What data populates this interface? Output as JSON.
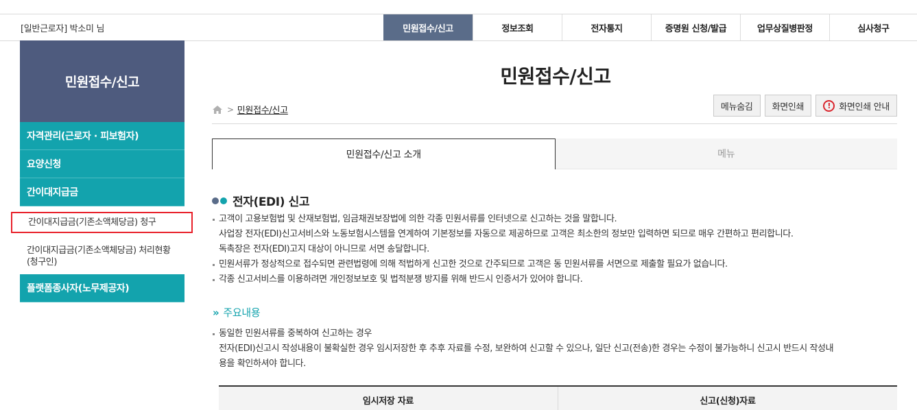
{
  "header": {
    "user": "[일반근로자] 박소미 님",
    "nav": [
      {
        "label": "민원접수/신고",
        "active": true
      },
      {
        "label": "정보조회",
        "active": false
      },
      {
        "label": "전자통지",
        "active": false
      },
      {
        "label": "증명원 신청/발급",
        "active": false
      },
      {
        "label": "업무상질병판정",
        "active": false
      },
      {
        "label": "심사청구",
        "active": false
      }
    ]
  },
  "sidebar": {
    "title": "민원접수/신고",
    "items": [
      {
        "label": "자격관리(근로자 · 피보험자)"
      },
      {
        "label": "요양신청"
      },
      {
        "label": "간이대지급금"
      }
    ],
    "subitems": [
      {
        "label": "간이대지급금(기존소액체당금) 청구",
        "highlighted": true
      },
      {
        "label": "간이대지급금(기존소액체당금) 처리현황(청구인)",
        "highlighted": false
      }
    ],
    "last_item": {
      "label": "플랫폼종사자(노무제공자)"
    }
  },
  "main": {
    "title": "민원접수/신고",
    "breadcrumb": {
      "home_icon": "home-icon",
      "current": "민원접수/신고"
    },
    "tools": {
      "hide_menu": "메뉴숨김",
      "print": "화면인쇄",
      "print_guide": "화면인쇄 안내"
    },
    "tabs": [
      {
        "label": "민원접수/신고 소개",
        "active": true
      },
      {
        "label": "메뉴",
        "active": false
      }
    ],
    "section_title": "전자(EDI) 신고",
    "bullets": [
      {
        "text": "고객이 고용보험법 및 산재보험법, 임금채권보장법에 의한 각종 민원서류를 인터넷으로 신고하는 것을 말합니다.",
        "type": "bullet"
      },
      {
        "text": "사업장 전자(EDI)신고서비스와 노동보험시스템을 연계하여 기본정보를 자동으로 제공하므로 고객은 최소한의 정보만 입력하면 되므로 매우 간편하고 편리합니다.",
        "type": "cont"
      },
      {
        "text": "독촉장은 전자(EDI)고지 대상이 아니므로 서면 송달합니다.",
        "type": "cont"
      },
      {
        "text": "민원서류가 정상적으로 접수되면 관련법령에 의해 적법하게 신고한 것으로 간주되므로 고객은 동 민원서류를 서면으로 제출할 필요가 없습니다.",
        "type": "bullet"
      },
      {
        "text": "각종 신고서비스를 이용하려면 개인정보보호 및 법적분쟁 방지를 위해 반드시 인증서가 있어야 합니다.",
        "type": "bullet"
      }
    ],
    "subsection_title": "주요내용",
    "bullets2": [
      {
        "text": "동일한 민원서류를 중복하여 신고하는 경우",
        "type": "bullet"
      },
      {
        "text": "전자(EDI)신고시 작성내용이 불확실한 경우 임시저장한 후 추후 자료를 수정, 보완하여 신고할 수 있으나, 일단 신고(전송)한 경우는 수정이 불가능하니 신고시 반드시 작성내",
        "type": "cont"
      },
      {
        "text": "용을 확인하셔야 합니다.",
        "type": "cont"
      }
    ],
    "table_headers": [
      "임시저장 자료",
      "신고(신청)자료"
    ]
  },
  "colors": {
    "nav_active": "#5a6c89",
    "sidebar_head": "#4e5b7e",
    "sidebar_item": "#13a3ad",
    "highlight_border": "#e8202a",
    "accent": "#13a3ad"
  }
}
